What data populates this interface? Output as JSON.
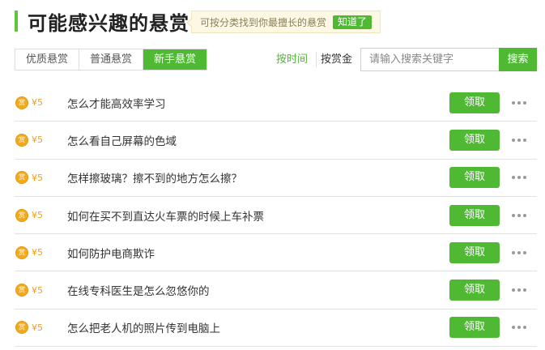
{
  "header": {
    "title": "可能感兴趣的悬赏"
  },
  "tip": {
    "text": "可按分类找到你最擅长的悬赏",
    "button": "知道了"
  },
  "tabs": [
    {
      "label": "优质悬赏",
      "active": false
    },
    {
      "label": "普通悬赏",
      "active": false
    },
    {
      "label": "新手悬赏",
      "active": true
    }
  ],
  "sort": {
    "by_time": "按时间",
    "by_amount": "按赏金"
  },
  "search": {
    "placeholder": "请输入搜索关键字",
    "button": "搜索"
  },
  "reward_icon_glyph": "赏",
  "claim_label": "领取",
  "questions": [
    {
      "amount": "¥5",
      "title": "怎么才能高效率学习"
    },
    {
      "amount": "¥5",
      "title": "怎么看自己屏幕的色域"
    },
    {
      "amount": "¥5",
      "title": "怎样擦玻璃？擦不到的地方怎么擦？"
    },
    {
      "amount": "¥5",
      "title": "如何在买不到直达火车票的时候上车补票"
    },
    {
      "amount": "¥5",
      "title": "如何防护电商欺诈"
    },
    {
      "amount": "¥5",
      "title": "在线专科医生是怎么忽悠你的"
    },
    {
      "amount": "¥5",
      "title": "怎么把老人机的照片传到电脑上"
    }
  ],
  "colors": {
    "accent": "#4fb934",
    "reward": "#f3a91c"
  }
}
